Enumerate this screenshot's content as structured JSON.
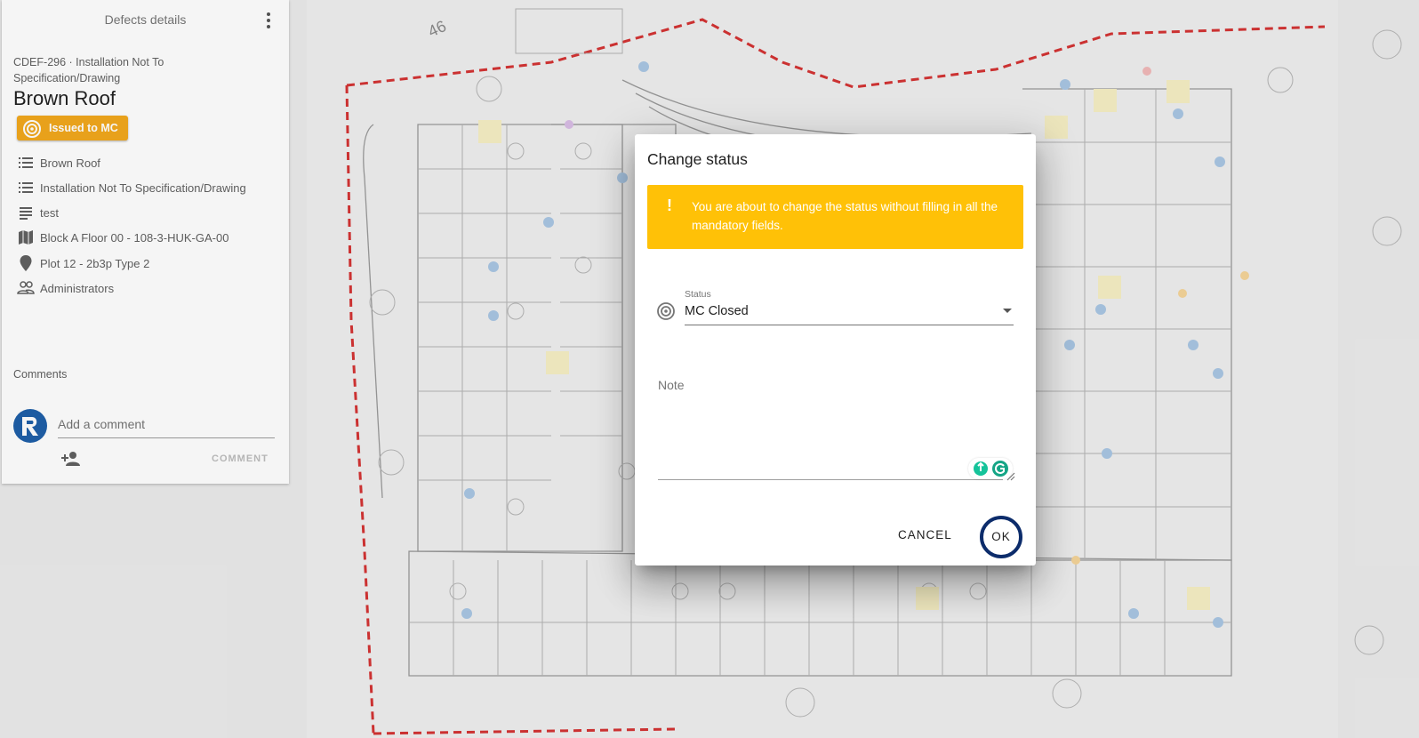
{
  "panel": {
    "title": "Defects details",
    "defect_code": "CDEF-296 · Installation Not To Specification/Drawing",
    "defect_title": "Brown Roof",
    "status_chip": "Issued to MC",
    "info_rows": [
      {
        "icon": "list-icon",
        "text": "Brown Roof"
      },
      {
        "icon": "list-icon",
        "text": "Installation Not To Specification/Drawing"
      },
      {
        "icon": "notes-icon",
        "text": "test"
      },
      {
        "icon": "map-icon",
        "text": "Block A Floor 00 - 108-3-HUK-GA-00"
      },
      {
        "icon": "location-pin-icon",
        "text": "Plot 12 - 2b3p Type 2"
      },
      {
        "icon": "group-icon",
        "text": "Administrators"
      }
    ],
    "comments_label": "Comments",
    "comment_placeholder": "Add a comment",
    "comment_button": "COMMENT"
  },
  "dialog": {
    "title": "Change status",
    "warning": "You are about to change the status without filling in all the mandatory fields.",
    "warning_mark": "!",
    "status_label": "Status",
    "status_value": "MC Closed",
    "note_label": "Note",
    "cancel_label": "CANCEL",
    "ok_label": "OK"
  },
  "plan": {
    "labels": [
      "46"
    ]
  },
  "colors": {
    "chip": "#f2a81d",
    "warning": "#ffc107",
    "ok_ring": "#0c2c6b",
    "boundary": "#cc1f1f"
  }
}
